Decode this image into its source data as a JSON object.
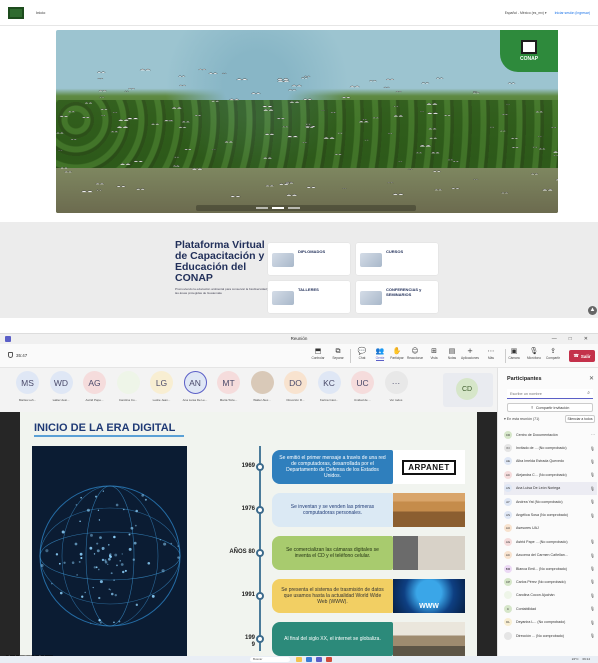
{
  "site": {
    "home_label": "Inicio",
    "language": "Español - México (es_mx) ▾",
    "login_label": "Iniciar sesión (Ingresar)",
    "banner_logo_text": "CONAP",
    "platform_title": "Plataforma Virtual de Capacitación y Educación del CONAP",
    "platform_subtitle": "Promoviendo la educación ambiental para conservar la biodiversidad y las áreas protegidas de Guatemala",
    "cards": [
      {
        "label": "DIPLOMADOS"
      },
      {
        "label": "CURSOS"
      },
      {
        "label": "TALLERES"
      },
      {
        "label": "CONFERENCIAS y SEMINARIOS"
      }
    ]
  },
  "teams": {
    "window_title": "Reunión",
    "window_buttons": [
      "—",
      "□",
      "✕"
    ],
    "timer": "35:47",
    "toolbar": [
      {
        "label": "Controlar",
        "icon": "⬒"
      },
      {
        "label": "Separar",
        "icon": "⧉"
      },
      {
        "label": "Chat",
        "icon": "💬"
      },
      {
        "label": "Gente",
        "icon": "👥",
        "badge": "71"
      },
      {
        "label": "Participar",
        "icon": "✋"
      },
      {
        "label": "Reaccionar",
        "icon": "☺"
      },
      {
        "label": "Vista",
        "icon": "⊞"
      },
      {
        "label": "Notas",
        "icon": "▤"
      },
      {
        "label": "Aplicaciones",
        "icon": "+"
      },
      {
        "label": "Más",
        "icon": "⋯"
      },
      {
        "label": "Cámara",
        "icon": "▣"
      },
      {
        "label": "Micrófono",
        "icon": "🎙"
      },
      {
        "label": "Compartir",
        "icon": "⇪"
      }
    ],
    "leave_label": "Salir",
    "participants": [
      {
        "initials": "MS",
        "name": "Marisa Leh...",
        "bg": "#dfe7f5"
      },
      {
        "initials": "WD",
        "name": "walter desi...",
        "bg": "#dfe7f5"
      },
      {
        "initials": "AG",
        "name": "Astrid Pape...",
        "bg": "#f5dcdc"
      },
      {
        "initials": "",
        "name": "Carolina Co...",
        "bg": "#eef5e8"
      },
      {
        "initials": "LG",
        "name": "Leslie Jean...",
        "bg": "#f8eed2"
      },
      {
        "initials": "AN",
        "name": "Ana Luisa De Le...",
        "bg": "#dfe7f5"
      },
      {
        "initials": "MT",
        "name": "Marta Torte...",
        "bg": "#f5dcdc"
      },
      {
        "initials": "",
        "name": "Walter Alex...",
        "bg": "#d9c9b8"
      },
      {
        "initials": "DO",
        "name": "Dirección R...",
        "bg": "#f8e3cf"
      },
      {
        "initials": "KC",
        "name": "Karina Cast...",
        "bg": "#dfe7f5"
      },
      {
        "initials": "UC",
        "name": "Unidad de ...",
        "bg": "#f5dcdc"
      },
      {
        "initials": "···",
        "name": "Ver todos",
        "bg": "#e8e8e8"
      }
    ],
    "self_tile_initials": "CD",
    "slide": {
      "title": "INICIO DE LA ERA DIGITAL",
      "timeline": [
        {
          "year": "1969",
          "text": "Se emitió el primer mensaje a través de una red de computadoras, desarrollada por el Departamento de Defensa de los Estados Unidos.",
          "style": "blue",
          "image": "ARPANET"
        },
        {
          "year": "1976",
          "text": "Se inventan y se venden las primeras computadoras personales.",
          "style": "lblue",
          "image": ""
        },
        {
          "year": "AÑOS 80",
          "text": "Se comercializan las cámaras digitales se inventa el CD y el teléfono celular.",
          "style": "green",
          "image": ""
        },
        {
          "year": "1991",
          "text": "Se presenta el sistema de trasmisión de datos que usamos hasta la actualidad World Wide Web (WWW).",
          "style": "yellow",
          "image": "WWW"
        },
        {
          "year": "199\n9",
          "text": "Al final del siglo XX, el internet se globaliza.",
          "style": "teal",
          "image": ""
        }
      ]
    },
    "presenter_name": "Ana Luisa De León Noriega",
    "panel": {
      "title": "Participantes",
      "search_placeholder": "Escribe un nombre",
      "share_label": "Compartir invitación",
      "in_meeting": "▾ En esta reunión (71)",
      "mute_all": "Silenciar a todos",
      "people": [
        {
          "initials": "CD",
          "name": "Centro de Documentación",
          "bg": "#d6e6c9",
          "mark": "···"
        },
        {
          "initials": "IN",
          "name": "Invitado de ... (No comprobado)",
          "bg": "#e5e5e5",
          "mark": "🎙"
        },
        {
          "initials": "AE",
          "name": "Alba Imelda Estrada Quevedo",
          "bg": "#dfe7f5",
          "mark": "🎙"
        },
        {
          "initials": "AC",
          "name": "Alejandra C... (No comprobado)",
          "bg": "#f5dcdc",
          "mark": "🎙"
        },
        {
          "initials": "AN",
          "name": "Ana Luisa De León Noriega",
          "bg": "#dfe7f5",
          "mark": "🎙"
        },
        {
          "initials": "AY",
          "name": "Andrea Yat (No comprobado)",
          "bg": "#dfe7f5",
          "mark": "🎙"
        },
        {
          "initials": "AS",
          "name": "Angélica Sosa (No comprobado)",
          "bg": "#dfe7f5",
          "mark": "🎙"
        },
        {
          "initials": "AU",
          "name": "Asesores UAJ",
          "bg": "#f8e3cf",
          "mark": ""
        },
        {
          "initials": "AG",
          "name": "Astrid Pape ... (No comprobado)",
          "bg": "#f5dcdc",
          "mark": "🎙"
        },
        {
          "initials": "AC",
          "name": "Azucena del Carmen Cañellan...",
          "bg": "#f8e3cf",
          "mark": "🎙"
        },
        {
          "initials": "BM",
          "name": "Blanca Emil... (No comprobado)",
          "bg": "#ecd9f5",
          "mark": "🎙"
        },
        {
          "initials": "CP",
          "name": "Carlos Pérez (No comprobado)",
          "bg": "#d6e6c9",
          "mark": "🎙"
        },
        {
          "initials": "",
          "name": "Carolina Cocon Ajuchán",
          "bg": "#eef5e8",
          "mark": "🎙"
        },
        {
          "initials": "C",
          "name": "Contabilidad",
          "bg": "#d6e6c9",
          "mark": "🎙"
        },
        {
          "initials": "DL",
          "name": "Deyanira L... (No comprobado)",
          "bg": "#f8eed2",
          "mark": "🎙"
        },
        {
          "initials": "",
          "name": "Dirección ... (No comprobado)",
          "bg": "#e5e5e5",
          "mark": "🎙"
        }
      ]
    }
  },
  "taskbar": {
    "search_placeholder": "Buscar",
    "weather": "22°C",
    "clock": "09:14"
  }
}
